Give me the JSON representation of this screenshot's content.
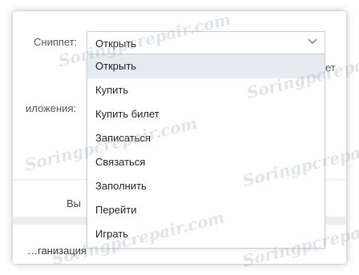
{
  "snippet": {
    "label": "Сниппет:",
    "selected": "Открыть"
  },
  "dropdown": {
    "items": [
      {
        "label": "Открыть",
        "active": true
      },
      {
        "label": "Купить"
      },
      {
        "label": "Купить билет"
      },
      {
        "label": "Записаться"
      },
      {
        "label": "Связаться"
      },
      {
        "label": "Заполнить"
      },
      {
        "label": "Перейти"
      },
      {
        "label": "Играть"
      }
    ]
  },
  "background": {
    "right_cut_text": "ет",
    "attachments_label": "иложения:",
    "section_text": "Вы",
    "bottom_text": "…ганизация"
  },
  "watermark": "Soringpcrepair.com",
  "colors": {
    "active_item_bg": "#e5ebf1",
    "border": "#c5d0db",
    "band": "#edeef0"
  },
  "icons": {
    "select_arrow": "chevron-down-icon"
  }
}
